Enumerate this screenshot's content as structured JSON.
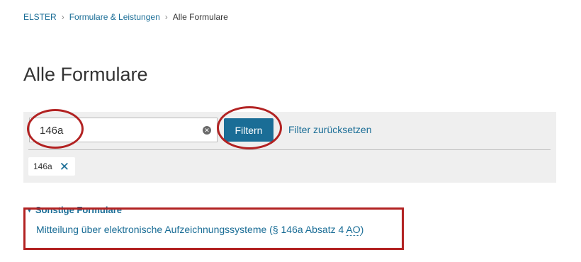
{
  "breadcrumb": {
    "items": [
      "ELSTER",
      "Formulare & Leistungen"
    ],
    "current": "Alle Formulare",
    "separator": "›"
  },
  "page_title": "Alle Formulare",
  "filter": {
    "search_value": "146a",
    "button_label": "Filtern",
    "reset_label": "Filter zurücksetzen",
    "chip_label": "146a"
  },
  "results": {
    "section_title": "Sonstige Formulare",
    "items": [
      {
        "text": "Mitteilung über elektronische Aufzeichnungssysteme (§ 146a Absatz 4 ",
        "abbr": "AO",
        "suffix": ")"
      }
    ]
  },
  "colors": {
    "accent": "#1a6d96",
    "annotation": "#b22222",
    "panel": "#efefef"
  },
  "icons": {
    "breadcrumb_separator": "chevron-right-icon",
    "clear": "clear-circle-icon",
    "chip_remove": "close-icon",
    "section_toggle": "chevron-down-icon"
  }
}
